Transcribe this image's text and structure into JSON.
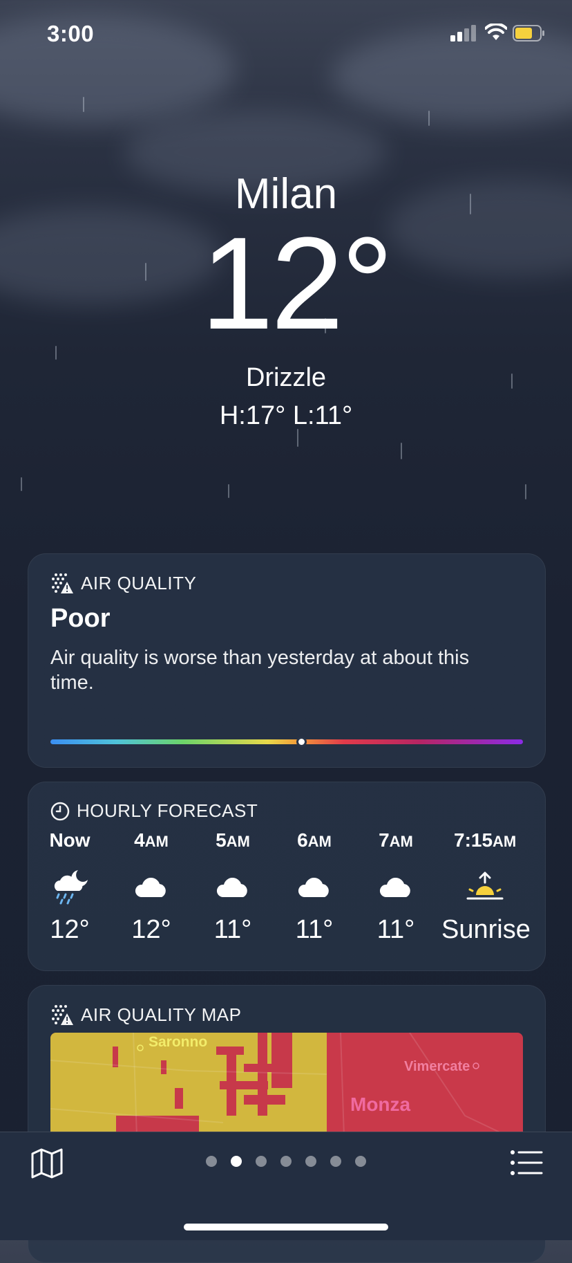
{
  "status_bar": {
    "time": "3:00"
  },
  "hero": {
    "city": "Milan",
    "temperature": "12°",
    "condition": "Drizzle",
    "high_low": "H:17°  L:11°"
  },
  "air_quality": {
    "heading": "AIR QUALITY",
    "level": "Poor",
    "description": "Air quality is worse than yesterday at about this time.",
    "scale_position": 0.53
  },
  "hourly": {
    "heading": "HOURLY FORECAST",
    "items": [
      {
        "label": "Now",
        "icon": "cloud-moon-rain-icon",
        "value": "12°"
      },
      {
        "label": "4AM",
        "icon": "cloud-icon",
        "value": "12°"
      },
      {
        "label": "5AM",
        "icon": "cloud-icon",
        "value": "11°"
      },
      {
        "label": "6AM",
        "icon": "cloud-icon",
        "value": "11°"
      },
      {
        "label": "7AM",
        "icon": "cloud-icon",
        "value": "11°"
      },
      {
        "label": "7:15AM",
        "icon": "sunrise-icon",
        "value": "Sunrise"
      }
    ]
  },
  "aq_map": {
    "heading": "AIR QUALITY MAP",
    "labels": {
      "saronno": "Saronno",
      "vimercate": "Vimercate",
      "monza": "Monza"
    }
  },
  "pager": {
    "count": 7,
    "active": 1
  },
  "colors": {
    "accent_sun": "#f6d13d",
    "aq_poor": "#c7394a",
    "aq_moderate": "#d2b73e"
  }
}
